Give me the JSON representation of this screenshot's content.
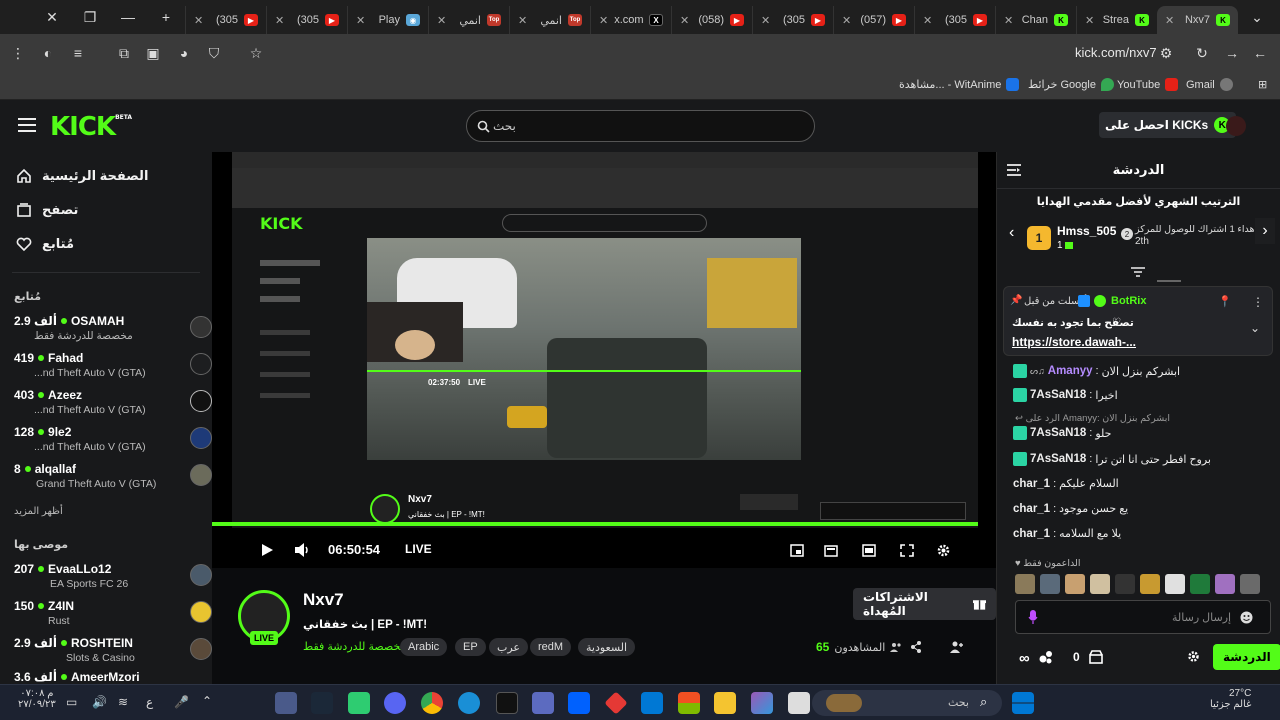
{
  "browser": {
    "tabs": [
      {
        "title": "Nxv7",
        "icon": "kick-icon",
        "active": true
      },
      {
        "title": "Strea",
        "icon": "kick-icon"
      },
      {
        "title": "Chan",
        "icon": "kick-icon"
      },
      {
        "title": "(305",
        "icon": "youtube-icon"
      },
      {
        "title": "(057)",
        "icon": "youtube-icon"
      },
      {
        "title": "(305",
        "icon": "youtube-icon"
      },
      {
        "title": "(058)",
        "icon": "youtube-icon"
      },
      {
        "title": "x.com",
        "icon": "x-icon"
      },
      {
        "title": "انمي",
        "icon": "top-icon"
      },
      {
        "title": "انمي",
        "icon": "top-icon"
      },
      {
        "title": "Play",
        "icon": "app-icon"
      },
      {
        "title": "(305",
        "icon": "youtube-icon"
      },
      {
        "title": "(305",
        "icon": "youtube-icon"
      }
    ],
    "url": "kick.com/nxv7",
    "bookmarks": [
      "Gmail",
      "YouTube",
      "خرائط Google",
      "مشاهدة... - WitAnime"
    ]
  },
  "header": {
    "search_placeholder": "بحث",
    "get_kicks_label": "احصل على KICKs"
  },
  "sidebar": {
    "nav": [
      {
        "label": "الصفحة الرئيسية",
        "icon": "home-icon"
      },
      {
        "label": "تصفح",
        "icon": "browse-icon"
      },
      {
        "label": "مُتابع",
        "icon": "heart-icon"
      }
    ],
    "following_title": "مُتابع",
    "following": [
      {
        "name": "OSAMAH",
        "count": "2.9 ألف",
        "game": "مخصصة للدردشة فقط"
      },
      {
        "name": "Fahad",
        "count": "419",
        "game": "...nd Theft Auto V (GTA)"
      },
      {
        "name": "Azeez",
        "count": "403",
        "game": "...nd Theft Auto V (GTA)"
      },
      {
        "name": "9le2",
        "count": "128",
        "game": "...nd Theft Auto V (GTA)"
      },
      {
        "name": "alqallaf",
        "count": "8",
        "game": "Grand Theft Auto V (GTA)"
      }
    ],
    "show_more": "أظهر المزيد",
    "recommended_title": "موصى بها",
    "recommended": [
      {
        "name": "EvaaLLo12",
        "count": "207",
        "game": "EA Sports FC 26"
      },
      {
        "name": "Z4IN",
        "count": "150",
        "game": "Rust"
      },
      {
        "name": "ROSHTEIN",
        "count": "2.9 ألف",
        "game": "Slots & Casino"
      },
      {
        "name": "AmeerMzori",
        "count": "3.6 ألف",
        "game": ""
      }
    ]
  },
  "player": {
    "time": "06:50:54",
    "live": "LIVE",
    "inner_time": "02:37:50",
    "inner_live": "LIVE",
    "inner_name": "Nxv7",
    "inner_title": "بث خفقاني | EP - !MT!"
  },
  "stream": {
    "name": "Nxv7",
    "live_badge": "LIVE",
    "title": "بث خفقاني | EP - !MT!",
    "category": "مخصصة للدردشة فقط",
    "tags": [
      "Arabic",
      "EP",
      "عرب",
      "redM",
      "السعودية"
    ],
    "subscribe_label": "الاشتراكات المُهداة",
    "viewers_label": "المشاهدون",
    "viewers": "65"
  },
  "chat": {
    "title": "الدردشة",
    "leaderboard_title": "الترتيب الشهري لأفضل مقدمي الهدايا",
    "top_gifter": {
      "name": "Hmss_505",
      "gifts": "1",
      "rank": "1"
    },
    "second_hint": "إهداء 1 اشتراك للوصول للمركز",
    "second_rank": "2th",
    "pinned": {
      "by": "أرسلت من قبل",
      "user": "BotRix",
      "text": "تصفح بما تجود به نفسك",
      "link": "https://store.dawah-..."
    },
    "messages": [
      {
        "user": "Amanyy",
        "color": "#b58cff",
        "text": "ابشركم بنزل الان"
      },
      {
        "user": "7AsSaN18",
        "color": "#ffffff",
        "text": "اخيرا"
      },
      {
        "reply_to": "الرد على Amanyy: ابشركم بنزل الان"
      },
      {
        "user": "7AsSaN18",
        "color": "#ffffff",
        "text": "حلو"
      },
      {
        "user": "7AsSaN18",
        "color": "#ffffff",
        "text": "بروح افطر حتى انا اتن ترا"
      },
      {
        "user": "char_1",
        "color": "#ffffff",
        "text": "السلام عليكم"
      },
      {
        "user": "char_1",
        "color": "#ffffff",
        "text": "يع حسن موجود"
      },
      {
        "user": "char_1",
        "color": "#ffffff",
        "text": "يلا مع السلامه"
      }
    ],
    "supporters_label": "الداعمون فقط",
    "input_placeholder": "إرسال رسالة",
    "send_label": "الدردشة",
    "points": "0"
  },
  "taskbar": {
    "search": "بحث",
    "temperature": "27°C",
    "weather_text": "غالم جزئيا",
    "time": "م ٠٧:٠٨",
    "date": "٢٧/٠٩/٢٣"
  }
}
